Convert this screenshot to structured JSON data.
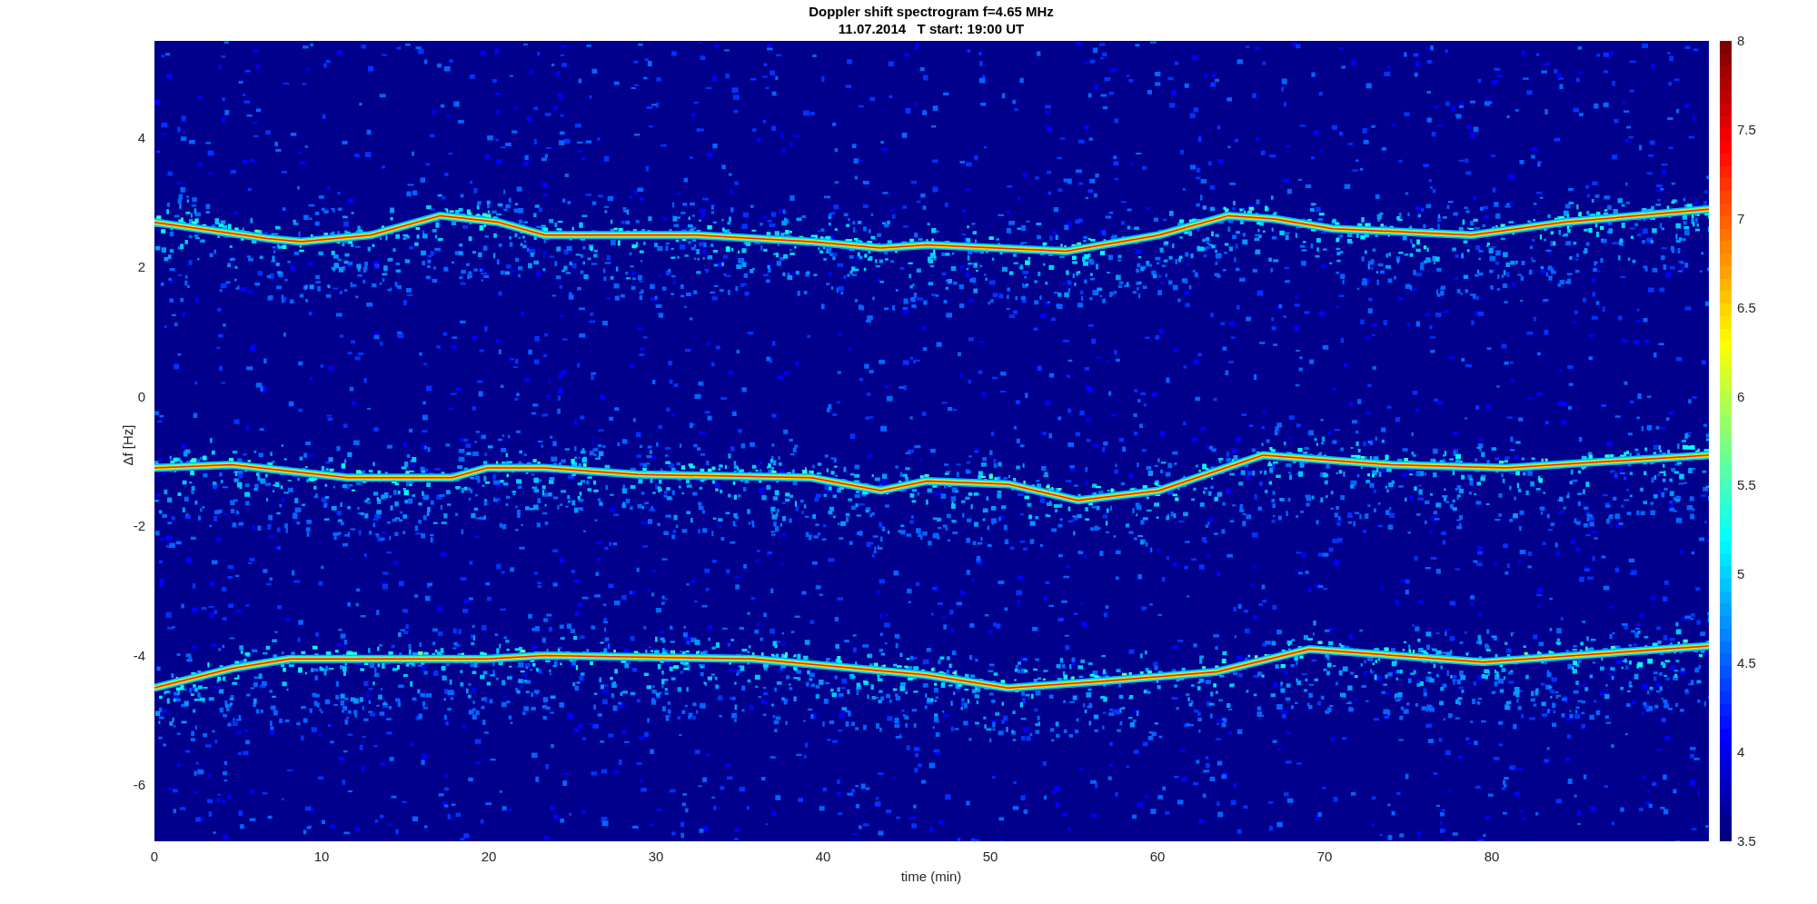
{
  "figure": {
    "title": "Doppler shift spectrogram f=4.65 MHz",
    "subtitle": "11.07.2014   T start: 19:00 UT",
    "xlabel": "time (min)",
    "ylabel": "Δf [Hz]",
    "xticks": [
      "0",
      "10",
      "20",
      "30",
      "40",
      "50",
      "60",
      "70",
      "80"
    ],
    "yticks": [
      "4",
      "2",
      "0",
      "-2",
      "-4",
      "-6"
    ],
    "colorbar_ticks": [
      "8",
      "7.5",
      "7",
      "6.5",
      "6",
      "5.5",
      "5",
      "4.5",
      "4",
      "3.5"
    ]
  }
}
